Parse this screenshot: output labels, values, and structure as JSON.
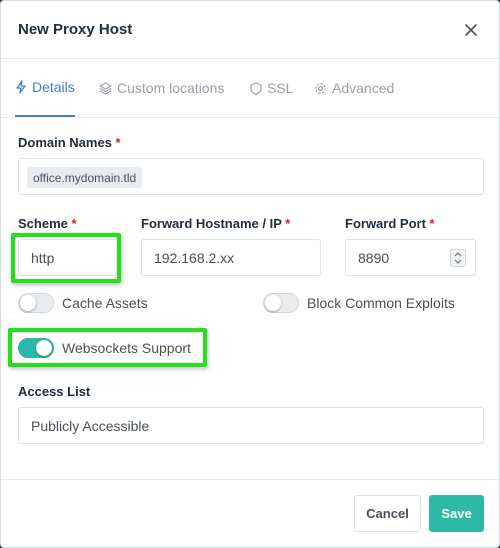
{
  "modal": {
    "title": "New Proxy Host"
  },
  "tabs": [
    {
      "label": "Details",
      "icon": "lightning-icon",
      "active": true
    },
    {
      "label": "Custom locations",
      "icon": "layers-icon",
      "active": false
    },
    {
      "label": "SSL",
      "icon": "shield-icon",
      "active": false
    },
    {
      "label": "Advanced",
      "icon": "gear-icon",
      "active": false
    }
  ],
  "form": {
    "domain_names": {
      "label": "Domain Names",
      "required": "*",
      "tags": [
        "office.mydomain.tld"
      ]
    },
    "scheme": {
      "label": "Scheme",
      "required": "*",
      "value": "http"
    },
    "forward_host": {
      "label": "Forward Hostname / IP",
      "required": "*",
      "value": "192.168.2.xx"
    },
    "forward_port": {
      "label": "Forward Port",
      "required": "*",
      "value": "8890"
    },
    "cache_assets": {
      "label": "Cache Assets",
      "enabled": false
    },
    "block_exploits": {
      "label": "Block Common Exploits",
      "enabled": false
    },
    "websockets": {
      "label": "Websockets Support",
      "enabled": true
    },
    "access_list": {
      "label": "Access List",
      "value": "Publicly Accessible"
    }
  },
  "footer": {
    "cancel_label": "Cancel",
    "save_label": "Save"
  },
  "colors": {
    "accent": "#467fcf",
    "toggle_on": "#2cb8a8",
    "save_button": "#2cbaa6",
    "highlight": "#22e01a",
    "required": "#cd201f"
  }
}
